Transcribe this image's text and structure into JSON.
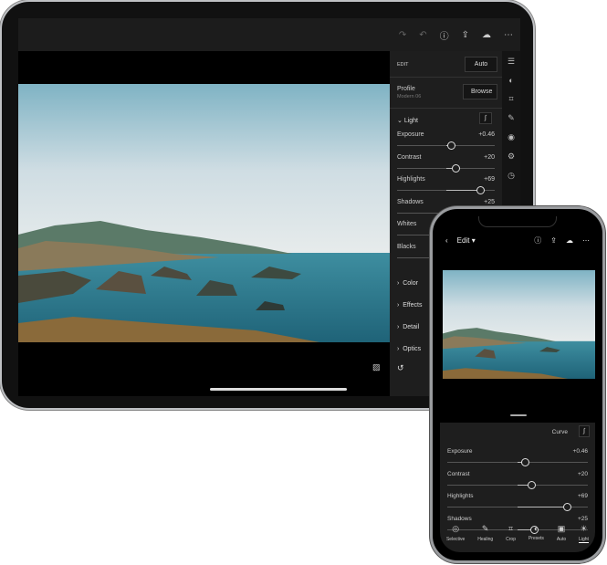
{
  "ipad": {
    "toolbar_icons": [
      "redo-icon",
      "undo-icon",
      "help-icon",
      "share-icon",
      "cloud-sync-icon",
      "more-icon"
    ],
    "edit_label": "EDIT",
    "auto_button": "Auto",
    "profile_label": "Profile",
    "profile_value": "Modern 06",
    "browse_button": "Browse",
    "light_section": "Light",
    "sliders": [
      {
        "label": "Exposure",
        "value": "+0.46",
        "position": 0.55
      },
      {
        "label": "Contrast",
        "value": "+20",
        "position": 0.6
      },
      {
        "label": "Highlights",
        "value": "+69",
        "position": 0.85
      },
      {
        "label": "Shadows",
        "value": "+25",
        "position": 0.62
      },
      {
        "label": "Whites",
        "value": "",
        "position": 0.5
      },
      {
        "label": "Blacks",
        "value": "",
        "position": 0.5
      }
    ],
    "sections": [
      "Color",
      "Effects",
      "Detail",
      "Optics"
    ],
    "side_icons": [
      "adjust-icon",
      "presets-icon",
      "crop-icon",
      "healing-icon",
      "selective-icon",
      "versions-icon",
      "history-icon"
    ]
  },
  "iphone": {
    "title": "Edit",
    "curve_label": "Curve",
    "sliders": [
      {
        "label": "Exposure",
        "value": "+0.46",
        "position": 0.55
      },
      {
        "label": "Contrast",
        "value": "+20",
        "position": 0.6
      },
      {
        "label": "Highlights",
        "value": "+69",
        "position": 0.85
      },
      {
        "label": "Shadows",
        "value": "+25",
        "position": 0.62
      }
    ],
    "tools": [
      {
        "label": "Selective",
        "icon": "◎"
      },
      {
        "label": "Healing",
        "icon": "✎"
      },
      {
        "label": "Crop",
        "icon": "⌗"
      },
      {
        "label": "Presets",
        "icon": "◐"
      },
      {
        "label": "Auto",
        "icon": "▣"
      },
      {
        "label": "Light",
        "icon": "☀"
      }
    ],
    "active_tool": "Light"
  }
}
